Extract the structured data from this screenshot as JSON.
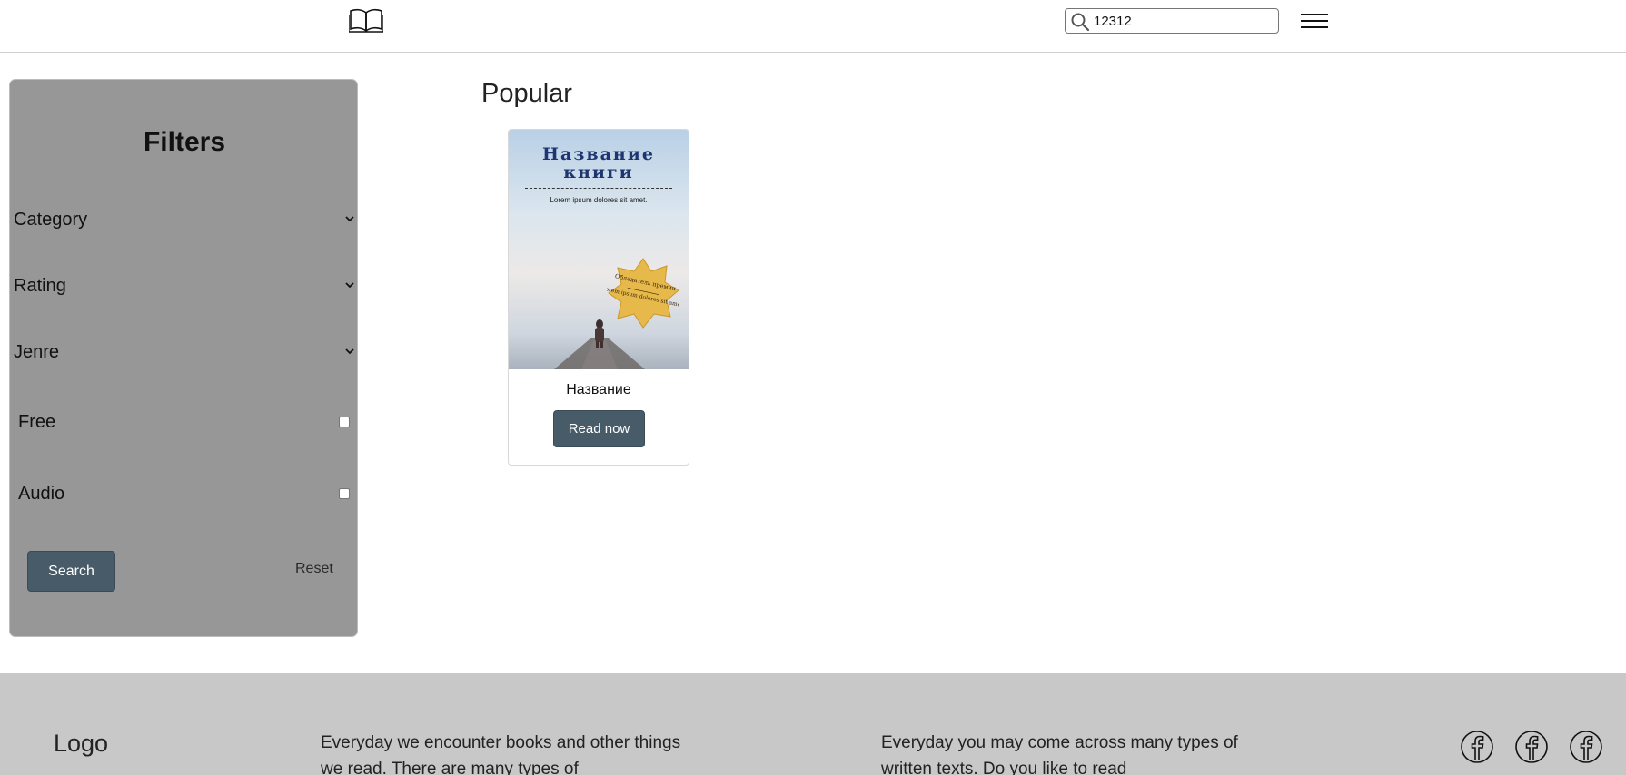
{
  "header": {
    "logo_icon": "open-book-icon",
    "search": {
      "value": "12312",
      "icon": "search-icon"
    },
    "menu_icon": "hamburger-menu-icon"
  },
  "filters": {
    "title": "Filters",
    "selects": [
      {
        "label": "Category"
      },
      {
        "label": "Rating"
      },
      {
        "label": "Jenre"
      }
    ],
    "checkboxes": [
      {
        "label": "Free",
        "checked": false
      },
      {
        "label": "Audio",
        "checked": false
      }
    ],
    "search_label": "Search",
    "reset_label": "Reset"
  },
  "main": {
    "section_title": "Popular",
    "books": [
      {
        "cover_title": "Название книги",
        "cover_subtitle": "Lorem ipsum dolores sit amet.",
        "badge_top": "Обладатель премии",
        "badge_bottom": "Lorem ipsum dolores sit amet",
        "name": "Название",
        "button_label": "Read now"
      }
    ]
  },
  "footer": {
    "logo": "Logo",
    "text_one": "Everyday we encounter books and other things we read. There are many types of",
    "text_two": "Everyday you may come across many types of written texts. Do you like to read",
    "social_icons": [
      "facebook-icon",
      "facebook-icon",
      "facebook-icon"
    ]
  },
  "colors": {
    "accent_button": "#485b69",
    "sidebar_bg": "#979797",
    "footer_bg": "#c8c8c8"
  }
}
